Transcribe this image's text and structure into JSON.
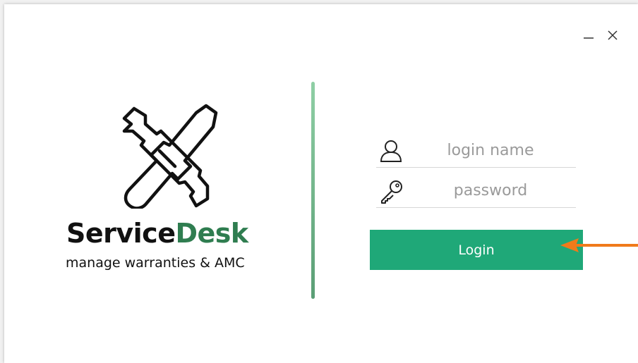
{
  "window": {
    "minimize_icon": "minimize-icon",
    "close_icon": "close-icon"
  },
  "logo": {
    "icon": "wrench-screwdriver-icon",
    "brand_part1": "Service",
    "brand_part2": "Desk",
    "tagline": "manage warranties & AMC"
  },
  "form": {
    "login_name": {
      "icon": "user-icon",
      "value": "",
      "placeholder": "login name"
    },
    "password": {
      "icon": "key-icon",
      "value": "",
      "placeholder": "password"
    },
    "login_button": "Login"
  },
  "annotation": {
    "arrow_color": "#f07a1a"
  },
  "colors": {
    "accent": "#1fa878",
    "brand_green": "#2f7d50",
    "divider": "#6aae84"
  }
}
